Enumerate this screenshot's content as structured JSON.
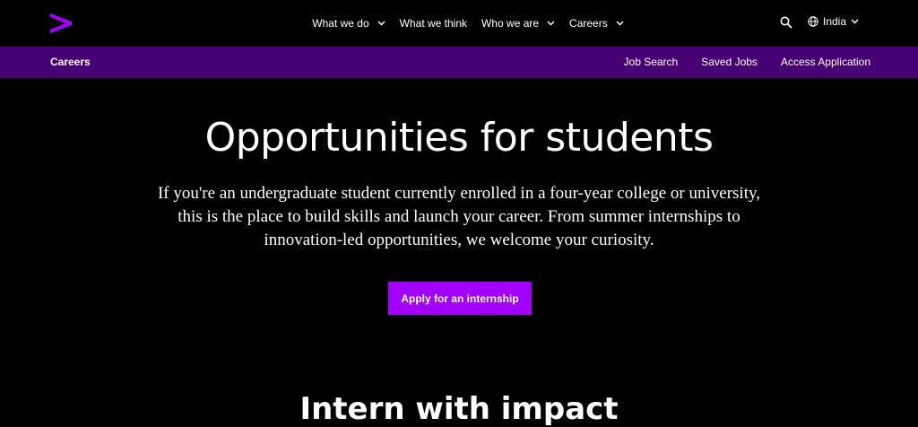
{
  "brand": {
    "accent": "#a100ff",
    "subnav_bg": "#460073"
  },
  "topnav": {
    "menu": [
      {
        "label": "What we do",
        "has_dropdown": true
      },
      {
        "label": "What we think",
        "has_dropdown": false
      },
      {
        "label": "Who we are",
        "has_dropdown": true
      },
      {
        "label": "Careers",
        "has_dropdown": true
      }
    ],
    "search_icon": "search-icon",
    "locale_label": "India"
  },
  "subnav": {
    "section": "Careers",
    "links": [
      "Job Search",
      "Saved Jobs",
      "Access Application"
    ]
  },
  "hero": {
    "title": "Opportunities for students",
    "text": "If you're an undergraduate student currently enrolled in a four-year college or university, this is the place to build skills and launch your career. From summer internships to innovation-led opportunities, we welcome your curiosity.",
    "cta_label": "Apply for an internship"
  },
  "next_section": {
    "title": "Intern with impact"
  }
}
